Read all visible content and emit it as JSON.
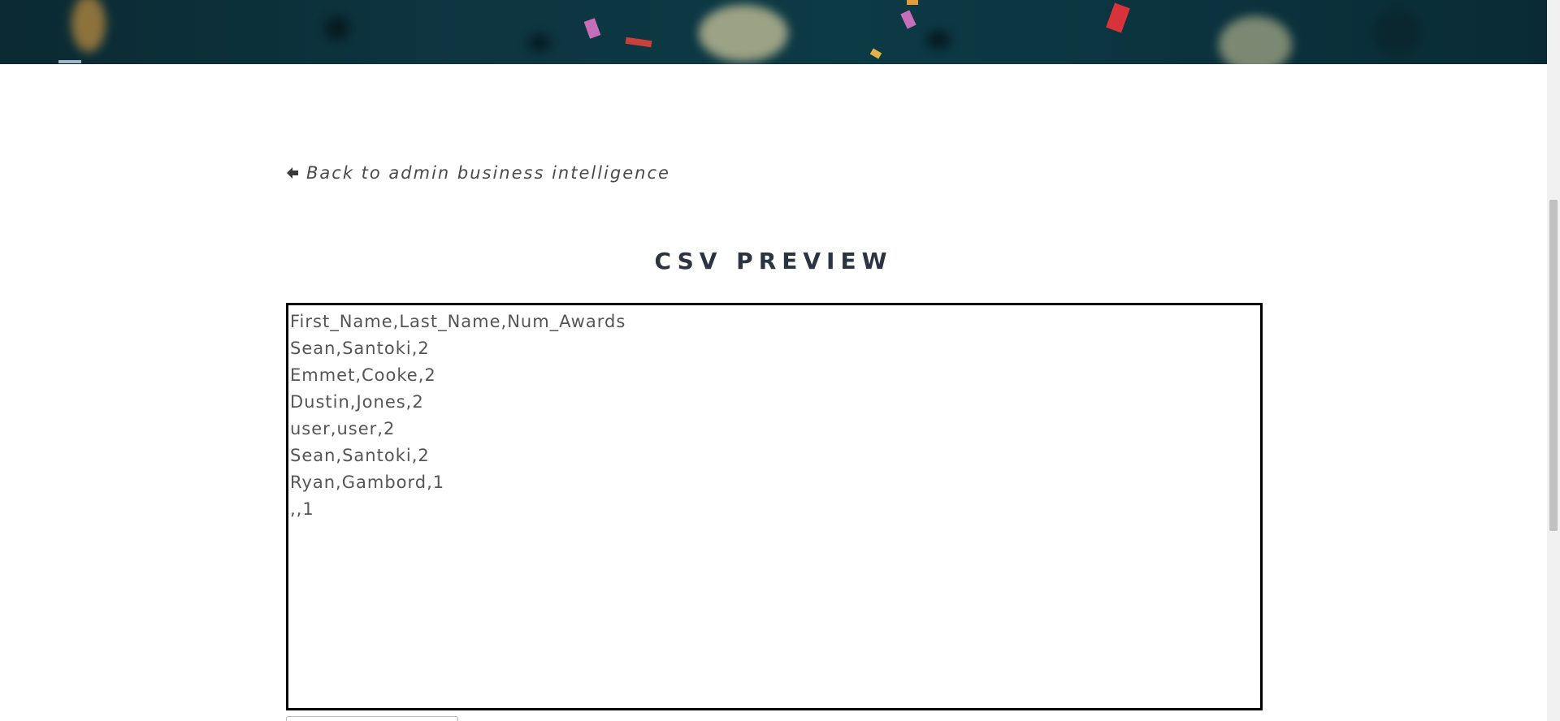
{
  "nav": {
    "back_icon": "arrow-left-icon",
    "back_label": "Back to admin business intelligence"
  },
  "section": {
    "title": "CSV PREVIEW"
  },
  "csv_preview": {
    "lines": [
      "First_Name,Last_Name,Num_Awards",
      "Sean,Santoki,2",
      "Emmet,Cooke,2",
      "Dustin,Jones,2",
      "user,user,2",
      "Sean,Santoki,2",
      "Ryan,Gambord,1",
      ",,1"
    ]
  },
  "colors": {
    "banner": "#0c3540",
    "title": "#2b3440",
    "text": "#555555",
    "box_border": "#000000"
  }
}
